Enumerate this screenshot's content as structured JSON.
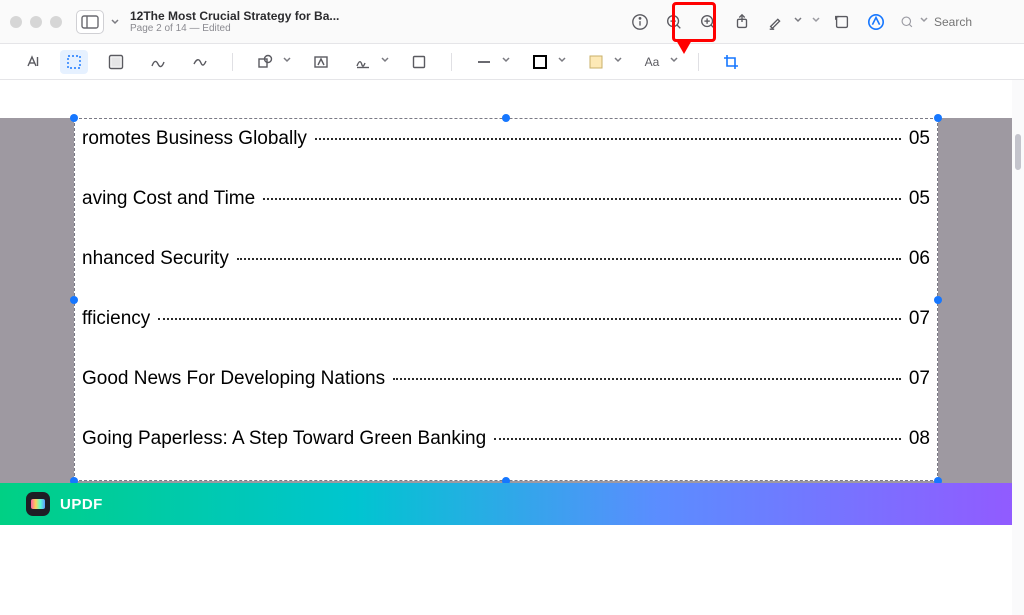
{
  "window": {
    "title": "12The Most Crucial Strategy for Ba...",
    "subtitle": "Page 2 of 14 — Edited"
  },
  "search": {
    "placeholder": "Search"
  },
  "toc": {
    "items": [
      {
        "title": "romotes Business Globally",
        "page": "05"
      },
      {
        "title": "aving Cost and Time",
        "page": "05"
      },
      {
        "title": "nhanced Security",
        "page": "06"
      },
      {
        "title": "fficiency",
        "page": "07"
      },
      {
        "title": "Good News For Developing Nations",
        "page": "07"
      },
      {
        "title": "Going Paperless: A Step Toward Green Banking",
        "page": "08"
      }
    ]
  },
  "brand": {
    "name": "UPDF"
  }
}
